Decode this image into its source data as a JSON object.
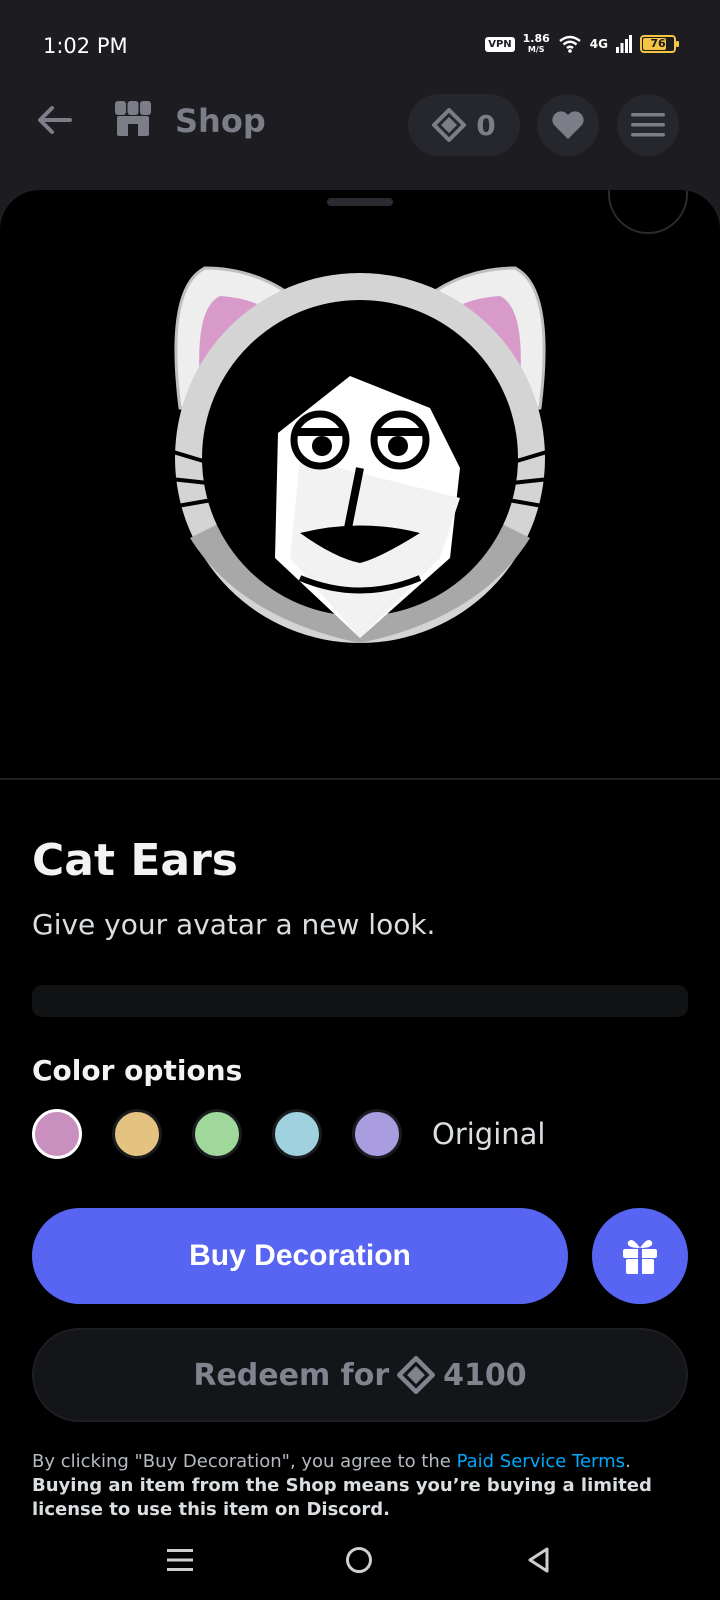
{
  "status_bar": {
    "time": "1:02 PM",
    "vpn": "VPN",
    "speed_value": "1.86",
    "speed_unit": "M/S",
    "network": "4G",
    "battery": "76"
  },
  "nav": {
    "title": "Shop",
    "orbs_count": "0"
  },
  "item": {
    "title": "Cat Ears",
    "description": "Give your avatar a new look.",
    "color_options_label": "Color options",
    "swatches": [
      "#c98fbf",
      "#e4c280",
      "#9fd89a",
      "#9fd2de",
      "#aa9ddf"
    ],
    "selected_swatch": 0,
    "original_label": "Original"
  },
  "actions": {
    "buy_label": "Buy Decoration",
    "redeem_prefix": "Redeem for",
    "redeem_amount": "4100"
  },
  "legal": {
    "prefix": "By clicking \"Buy Decoration\", you agree to the ",
    "link": "Paid Service Terms",
    "dot": ". ",
    "bold": "Buying an item from the Shop means you’re buying a limited license to use this item on Discord."
  },
  "colors": {
    "accent": "#5865f2",
    "link": "#00a8fc",
    "background": "#1c1c21"
  }
}
